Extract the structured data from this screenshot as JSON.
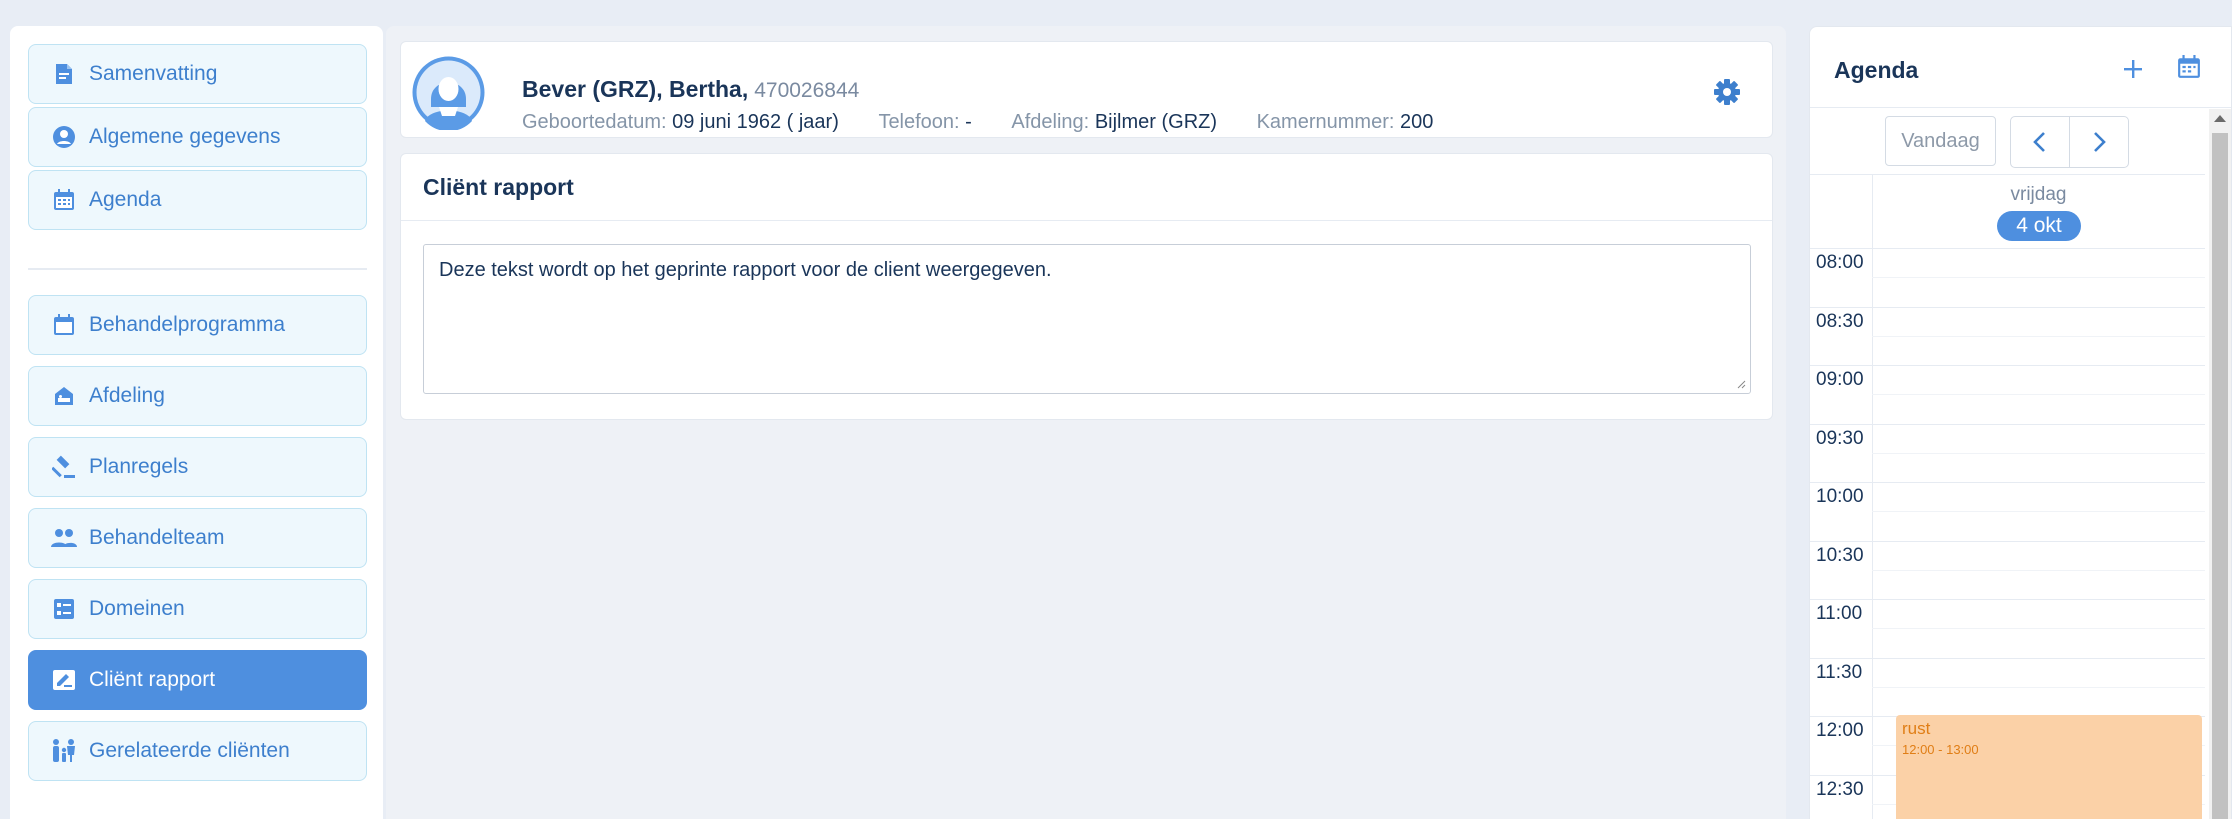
{
  "sidebar": {
    "items": [
      {
        "label": "Samenvatting",
        "icon": "document-icon"
      },
      {
        "label": "Algemene gegevens",
        "icon": "user-circle-icon"
      },
      {
        "label": "Agenda",
        "icon": "calendar-grid-icon"
      },
      {
        "label": "Behandelprogramma",
        "icon": "calendar-icon"
      },
      {
        "label": "Afdeling",
        "icon": "ward-bed-icon"
      },
      {
        "label": "Planregels",
        "icon": "gavel-icon"
      },
      {
        "label": "Behandelteam",
        "icon": "team-icon"
      },
      {
        "label": "Domeinen",
        "icon": "checklist-icon"
      },
      {
        "label": "Cliënt rapport",
        "icon": "signature-icon",
        "active": true
      },
      {
        "label": "Gerelateerde cliënten",
        "icon": "family-icon"
      }
    ]
  },
  "patient": {
    "name": "Bever (GRZ), Bertha,",
    "id": "470026844",
    "birth_label": "Geboortedatum:",
    "birth_value": "09 juni 1962 ( jaar)",
    "phone_label": "Telefoon:",
    "phone_value": "-",
    "ward_label": "Afdeling:",
    "ward_value": "Bijlmer (GRZ)",
    "room_label": "Kamernummer:",
    "room_value": "200"
  },
  "report": {
    "title": "Cliënt rapport",
    "text": "Deze tekst wordt op het geprinte rapport voor de client weergegeven."
  },
  "agenda": {
    "title": "Agenda",
    "today_label": "Vandaag",
    "day_name": "vrijdag",
    "day_date": "4 okt",
    "times": [
      "08:00",
      "08:30",
      "09:00",
      "09:30",
      "10:00",
      "10:30",
      "11:00",
      "11:30",
      "12:00",
      "12:30"
    ],
    "event": {
      "title": "rust",
      "time": "12:00 - 13:00"
    }
  },
  "colors": {
    "accent": "#4e8fdf",
    "nav_bg": "#eef8fd",
    "event_bg": "#fbd1a7",
    "event_text": "#e07e16"
  }
}
